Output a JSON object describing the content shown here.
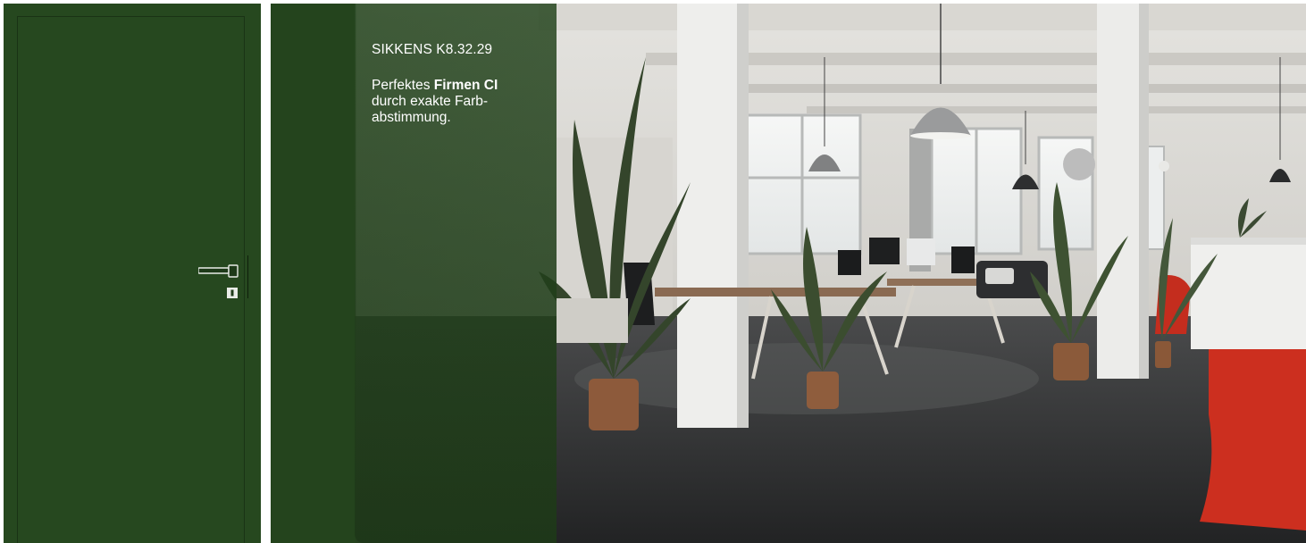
{
  "door": {
    "color": "#26481f",
    "handle_icon": "door-handle-icon",
    "lock_icon": "keyhole-icon"
  },
  "swatch": {
    "color": "#24441d",
    "code": "SIKKENS K8.32.29",
    "line1_prefix": "Perfektes ",
    "line1_bold": "Firmen CI",
    "line2": "durch exakte Farb-",
    "line3": "abstimmung."
  },
  "scene": {
    "subject": "office-interior-photo"
  }
}
